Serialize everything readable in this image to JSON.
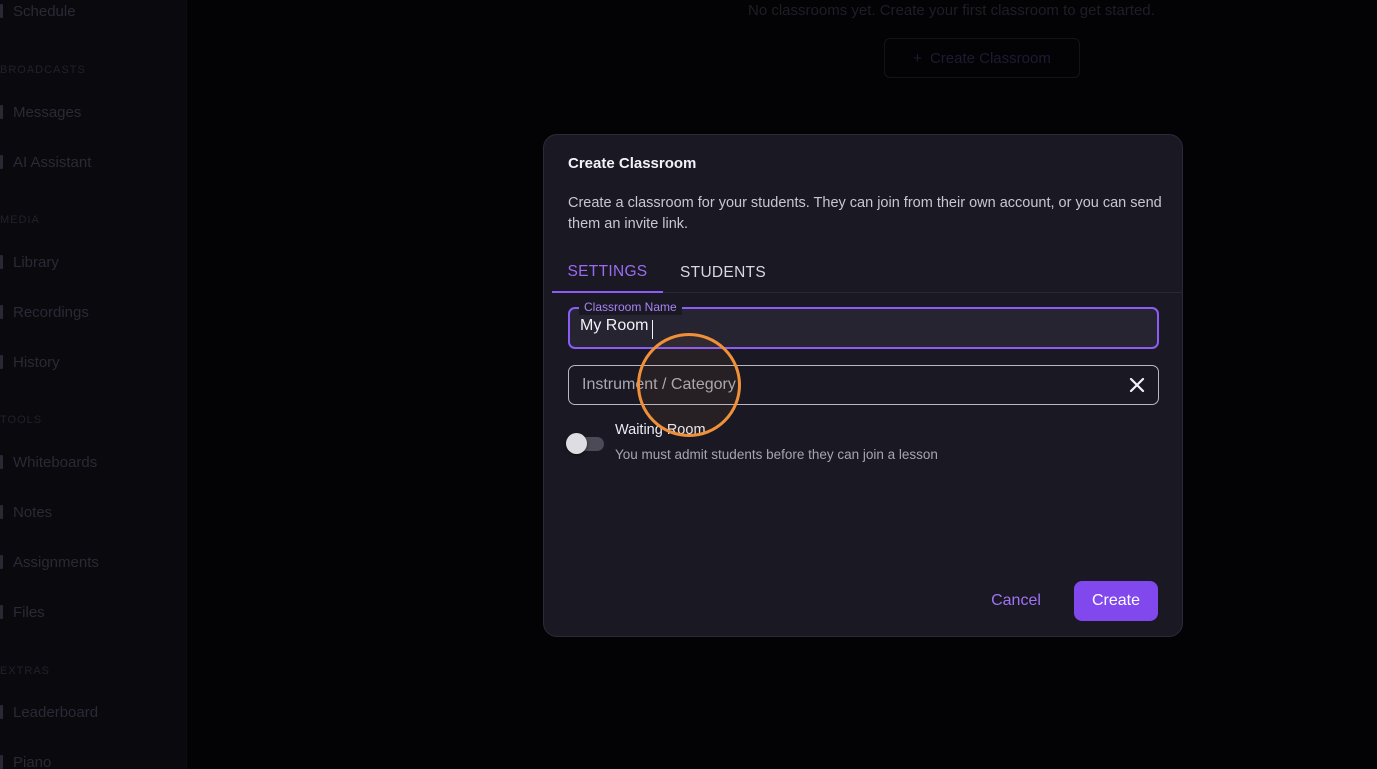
{
  "sidebar": {
    "items": [
      {
        "label": "Schedule"
      },
      {
        "label": "Messages"
      },
      {
        "label": "AI Assistant"
      },
      {
        "label": "Library"
      },
      {
        "label": "Recordings"
      },
      {
        "label": "History"
      },
      {
        "label": "Whiteboards"
      },
      {
        "label": "Notes"
      },
      {
        "label": "Assignments"
      },
      {
        "label": "Files"
      },
      {
        "label": "Leaderboard"
      },
      {
        "label": "Piano"
      }
    ],
    "sections": [
      "Broadcasts",
      "Media",
      "Tools",
      "Extras"
    ]
  },
  "background": {
    "empty_message": "No classrooms yet. Create your first classroom to get started.",
    "create_button": "Create Classroom",
    "create_button_icon": "plus-icon"
  },
  "dialog": {
    "title": "Create Classroom",
    "description": "Create a classroom for your students. They can join from their own account, or you can send them an invite link.",
    "tabs": [
      {
        "label": "SETTINGS",
        "active": true
      },
      {
        "label": "STUDENTS",
        "active": false
      }
    ],
    "classroom_name": {
      "label": "Classroom Name",
      "value": "My Room"
    },
    "category": {
      "placeholder": "Instrument / Category",
      "clear_icon": "close-icon"
    },
    "waiting_room": {
      "label": "Waiting Room",
      "description": "You must admit students before they can join a lesson",
      "enabled": false
    },
    "cancel_label": "Cancel",
    "create_label": "Create"
  },
  "colors": {
    "accent": "#8b5cf6",
    "primary_button": "#8148ee",
    "dialog_bg": "#1a1823",
    "click_indicator": "#f0913a"
  }
}
